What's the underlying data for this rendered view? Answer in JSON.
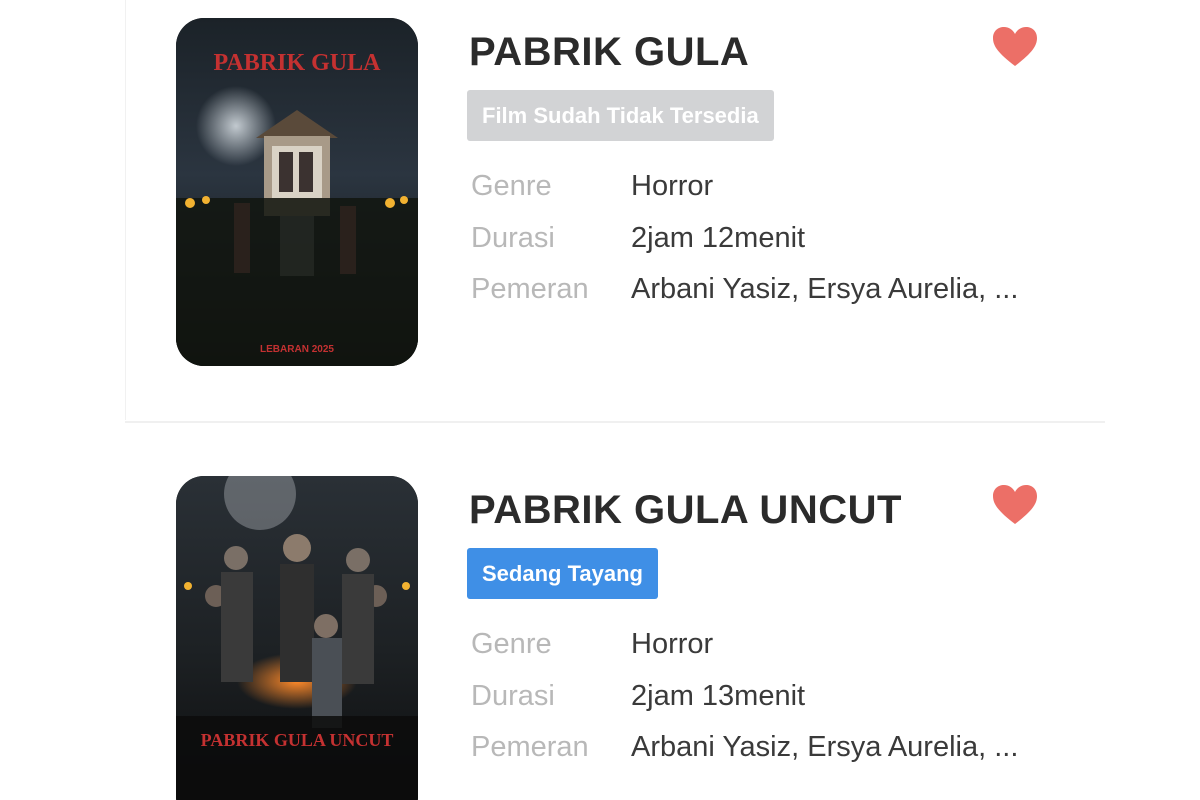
{
  "colors": {
    "heart": "#ec6f67",
    "badge_unavailable": "#d2d3d5",
    "badge_playing": "#3f8fe6",
    "title": "#2b2b2b",
    "label": "#b8b8b8",
    "value": "#3a3a3a"
  },
  "icons": {
    "favorite": "heart-icon"
  },
  "movies": [
    {
      "poster": {
        "title_text": "PABRIK GULA",
        "date_text": "LEBARAN 2025"
      },
      "title": "PABRIK GULA",
      "status": "Film Sudah Tidak Tersedia",
      "details": [
        {
          "label": "Genre",
          "value": "Horror"
        },
        {
          "label": "Durasi",
          "value": "2jam 12menit"
        },
        {
          "label": "Pemeran",
          "value": "Arbani Yasiz, Ersya Aurelia, ..."
        }
      ]
    },
    {
      "poster": {
        "title_text": "PABRIK GULA UNCUT"
      },
      "title": "PABRIK GULA UNCUT",
      "status": "Sedang Tayang",
      "details": [
        {
          "label": "Genre",
          "value": "Horror"
        },
        {
          "label": "Durasi",
          "value": "2jam 13menit"
        },
        {
          "label": "Pemeran",
          "value": "Arbani Yasiz, Ersya Aurelia, ..."
        }
      ]
    }
  ]
}
